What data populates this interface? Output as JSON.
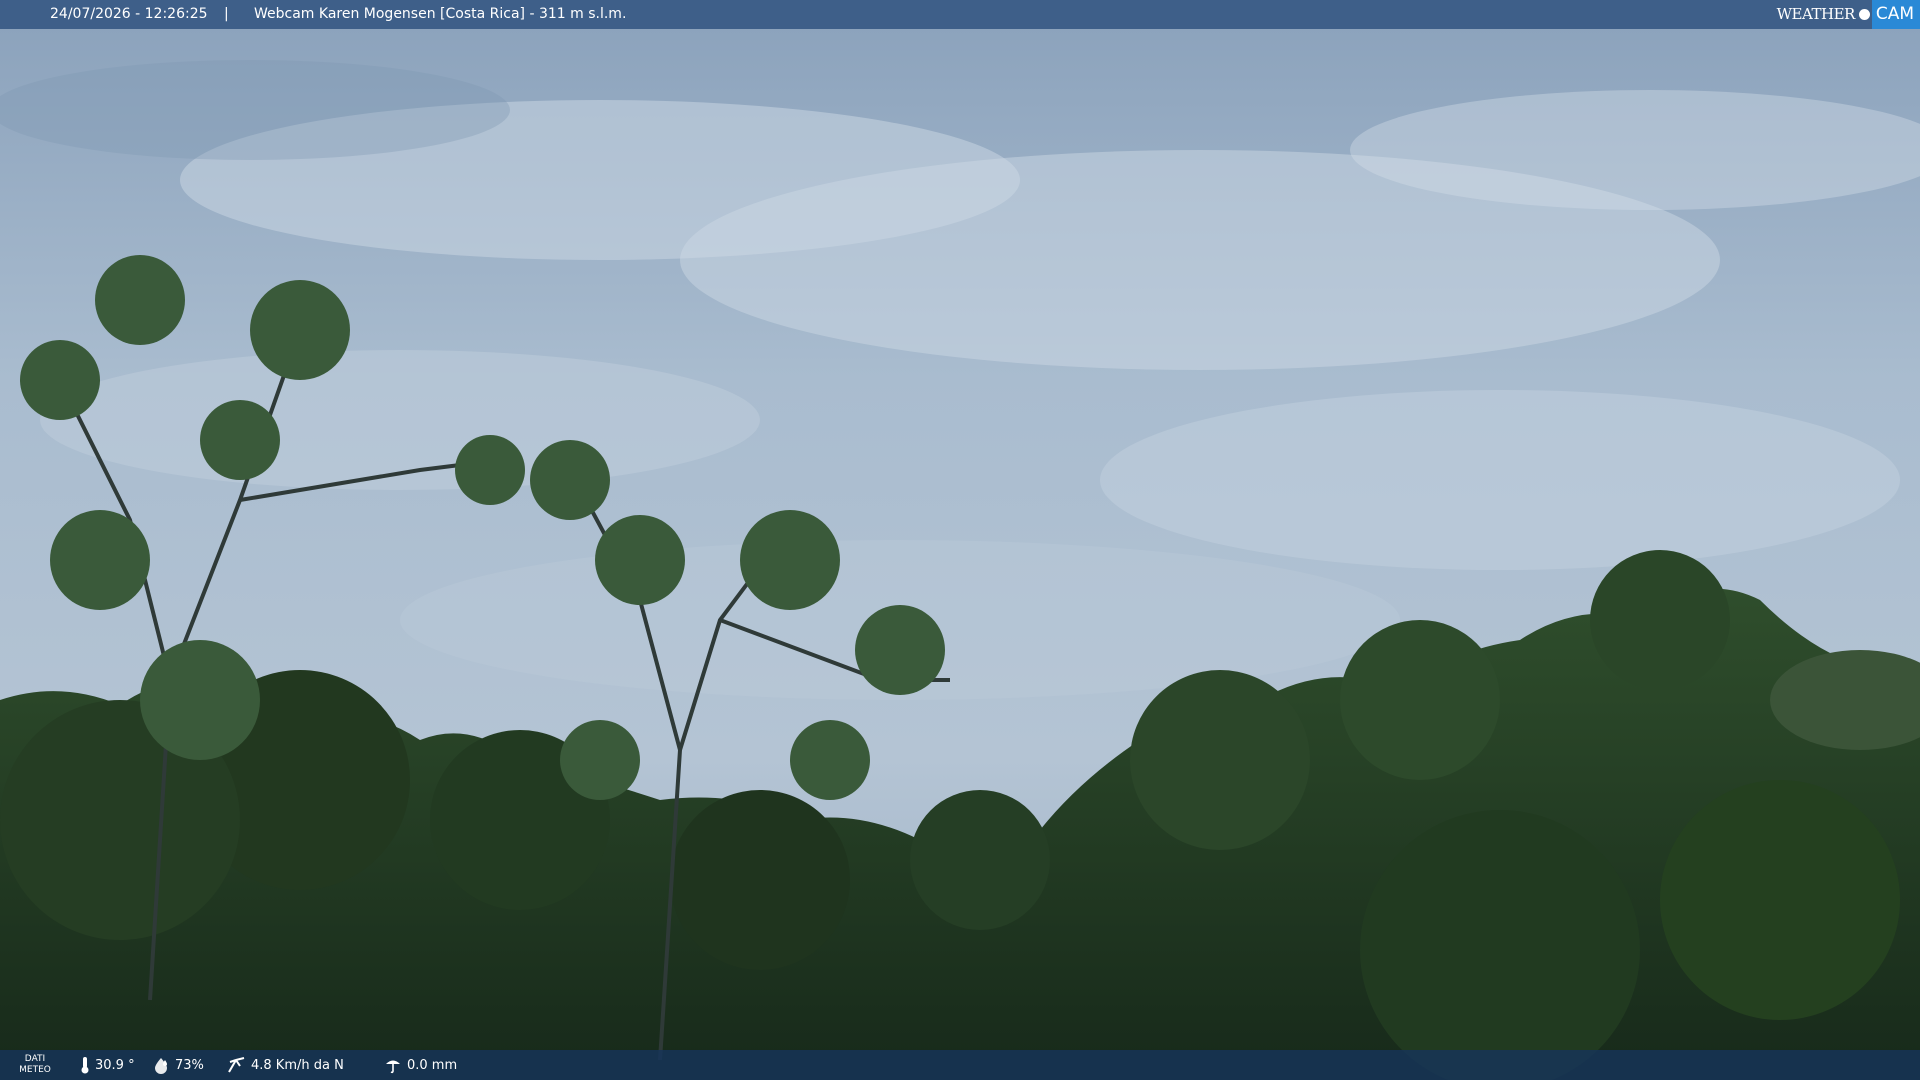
{
  "overlay": {
    "datetime": "24/07/2026 - 12:26:25",
    "separator": "|",
    "title": "Webcam Karen Mogensen [Costa Rica]  - 311 m s.l.m.",
    "logo": {
      "left": "WEATHER",
      "right": "CAM"
    }
  },
  "weather": {
    "label_line1": "DATI",
    "label_line2": "METEO",
    "temperature": "30.9 °",
    "humidity": "73%",
    "wind": "4.8 Km/h da N",
    "rain": "0.0 mm"
  },
  "icons": [
    "thermometer-icon",
    "humidity-icon",
    "wind-icon",
    "rain-icon"
  ],
  "colors": {
    "top_bar": "#305480",
    "bottom_bar": "#16345a",
    "logo_accent": "#2a89d6"
  }
}
